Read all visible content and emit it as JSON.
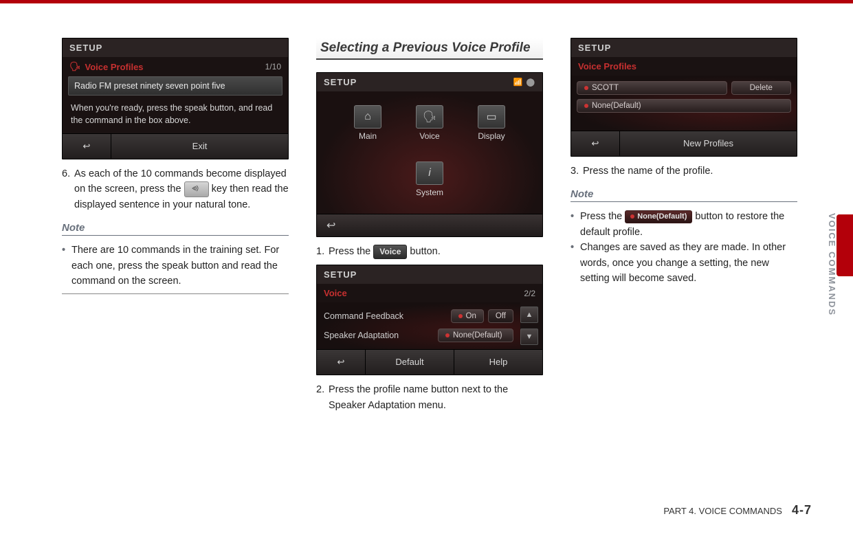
{
  "section_heading": "Selecting a Previous Voice Profile",
  "side_label": "VOICE COMMANDS",
  "footer": {
    "part": "PART 4. VOICE COMMANDS",
    "page": "4-7"
  },
  "col1": {
    "shot": {
      "title": "SETUP",
      "sub_red": "Voice Profiles",
      "count": "1/10",
      "highlight": "Radio FM preset ninety seven point five",
      "hint": "When you're ready, press the speak button, and read the command in the box above.",
      "btn_back": "↩",
      "btn_exit": "Exit"
    },
    "step6_num": "6.",
    "step6_a": "As each of the 10 commands become displayed on the screen, press the ",
    "step6_b": " key then read the displayed sentence in your natural tone.",
    "note_h": "Note",
    "note_b": "There are 10 commands in the training set. For each one, press the speak button and read the command on the screen."
  },
  "col2": {
    "shot1": {
      "title": "SETUP",
      "icons": {
        "main": "Main",
        "voice": "Voice",
        "display": "Display",
        "system": "System"
      },
      "back": "↩"
    },
    "step1_num": "1.",
    "step1_a": "Press the ",
    "step1_key": "Voice",
    "step1_b": " button.",
    "shot2": {
      "title": "SETUP",
      "sub_red": "Voice",
      "count": "2/2",
      "row1_lbl": "Command Feedback",
      "row1_on": "On",
      "row1_off": "Off",
      "row2_lbl": "Speaker Adaptation",
      "row2_val": "None(Default)",
      "btn_back": "↩",
      "btn_default": "Default",
      "btn_help": "Help"
    },
    "step2_num": "2.",
    "step2": "Press the profile name button next to the Speaker Adaptation menu."
  },
  "col3": {
    "shot": {
      "title": "SETUP",
      "sub_red": "Voice Profiles",
      "p1": "SCOTT",
      "del": "Delete",
      "p2": "None(Default)",
      "btn_back": "↩",
      "btn_new": "New Profiles"
    },
    "step3_num": "3.",
    "step3": "Press the name of the profile.",
    "note_h": "Note",
    "n1_a": "Press the ",
    "n1_key": "None(Default)",
    "n1_b": " button to restore the default profile.",
    "n2": "Changes are saved as they are made. In other words, once you change a setting, the new setting will become saved."
  }
}
